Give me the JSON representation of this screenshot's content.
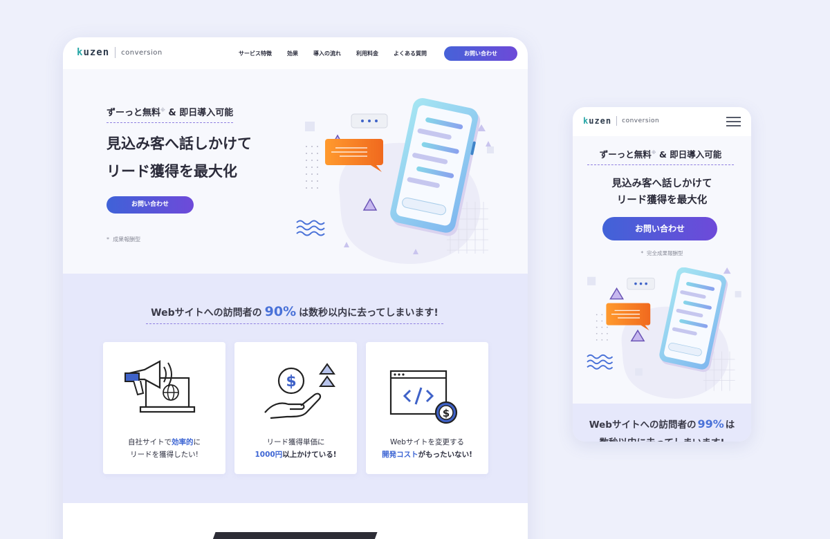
{
  "brand": {
    "logo_word": "kuzen",
    "logo_first": "k",
    "logo_rest": "uzen",
    "logo_sub": "conversion"
  },
  "colors": {
    "accent": "#4a72d8",
    "cta_start": "#4062d8",
    "cta_end": "#6e4ad9",
    "band": "#e6e8fb",
    "dash": "#8f7fe0"
  },
  "nav": {
    "items": [
      "サービス特徴",
      "効果",
      "導入の流れ",
      "利用料金",
      "よくある質問"
    ],
    "cta": "お問い合わせ"
  },
  "hero": {
    "tag_main": "ずーっと無料",
    "tag_mark": "※",
    "tag_rest": "& 即日導入可能",
    "headline1": "見込み客へ話しかけて",
    "headline2": "リード獲得を最大化",
    "cta": "お問い合わせ",
    "note_mark": "*",
    "note": "成果報酬型"
  },
  "problem": {
    "title_pre": "Webサイトへの訪問者の",
    "title_pct": "90%",
    "title_post": "は数秒以内に去ってしまいます!",
    "cards": [
      {
        "icon": "megaphone-laptop-icon",
        "l1_pre": "自社サイトで",
        "l1_hl": "効率的",
        "l1_post": "に",
        "l2_pre": "リードを獲得したい!",
        "l2_hl": "",
        "l2_post": ""
      },
      {
        "icon": "dollar-hand-icon",
        "l1_pre": "リード獲得単価に",
        "l1_hl": "",
        "l1_post": "",
        "l2_pre": "",
        "l2_hl": "1000円",
        "l2_post": "以上かけている!"
      },
      {
        "icon": "code-window-icon",
        "l1_pre": "Webサイトを変更する",
        "l1_hl": "",
        "l1_post": "",
        "l2_pre": "",
        "l2_hl": "開発コスト",
        "l2_post": "がもったいない!"
      }
    ]
  },
  "mobile": {
    "tag_main": "ずーっと無料",
    "tag_mark": "※",
    "tag_rest": "& 即日導入可能",
    "headline1": "見込み客へ話しかけて",
    "headline2": "リード獲得を最大化",
    "cta": "お問い合わせ",
    "note_mark": "*",
    "note": "完全成果報酬型",
    "band_pre": "Webサイトへの訪問者の",
    "band_pct": "99%",
    "band_post": "は",
    "band_l2": "数秒以内に去ってしまいます!",
    "menu_icon": "hamburger-menu-icon"
  }
}
